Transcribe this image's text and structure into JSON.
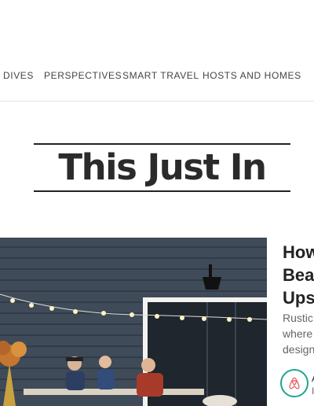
{
  "nav": {
    "items": [
      {
        "label": "DIVES"
      },
      {
        "label": "PERSPECTIVES"
      },
      {
        "label": "SMART TRAVEL"
      },
      {
        "label": "HOSTS AND HOMES"
      }
    ]
  },
  "section": {
    "heading": "This Just In"
  },
  "story": {
    "title_lines": [
      "How",
      "Bea",
      "Ups"
    ],
    "desc_lines": [
      "Rustic",
      "where",
      "design"
    ],
    "author_badge_initial": "A",
    "author_sub_initial": "I",
    "badge_icon": "airbnb-logo-icon",
    "accent_color": "#1fa58f"
  }
}
